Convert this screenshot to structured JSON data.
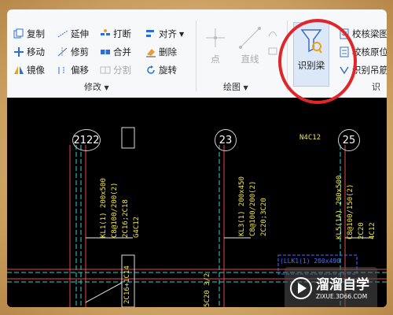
{
  "ribbon": {
    "modify": {
      "label": "修改",
      "copy": "复制",
      "extend": "延伸",
      "break": "打断",
      "align": "对齐",
      "move": "移动",
      "trim": "修剪",
      "merge": "合并",
      "delete": "删除",
      "mirror": "镜像",
      "offset": "偏移",
      "split": "分割",
      "rotate": "旋转"
    },
    "draw": {
      "label": "绘图",
      "point": "点",
      "line": "直线"
    },
    "recognize": {
      "identify_beam": "识别梁",
      "check_beam_drawing": "校核梁图",
      "check_origin": "校核原位",
      "identify_hanger": "识别吊筋",
      "group_label_partial": "识"
    }
  },
  "cad": {
    "axis_labels": [
      "2122",
      "23",
      "25"
    ],
    "top_text": "N4C12",
    "beam_texts_left": [
      "KL1(1) 200x500",
      "C8@100/200(2)",
      "2C16;2C18",
      "G4C12"
    ],
    "beam_texts_mid": [
      "KL3(1) 200x450",
      "C8@100/200(2)",
      "2C20;3C20"
    ],
    "beam_texts_right": [
      "KL5(1A) 200x500",
      "C8@100/150(2)",
      "2C20",
      "4C12"
    ],
    "blue_text": "(LLK1(1) 200x490",
    "bottom_mid_text": "5C20 3/2",
    "bottom_left_text": "2C16+1C14"
  },
  "watermark": {
    "brand": "溜溜自学",
    "url": "ZIXUE.3D66.COM"
  }
}
